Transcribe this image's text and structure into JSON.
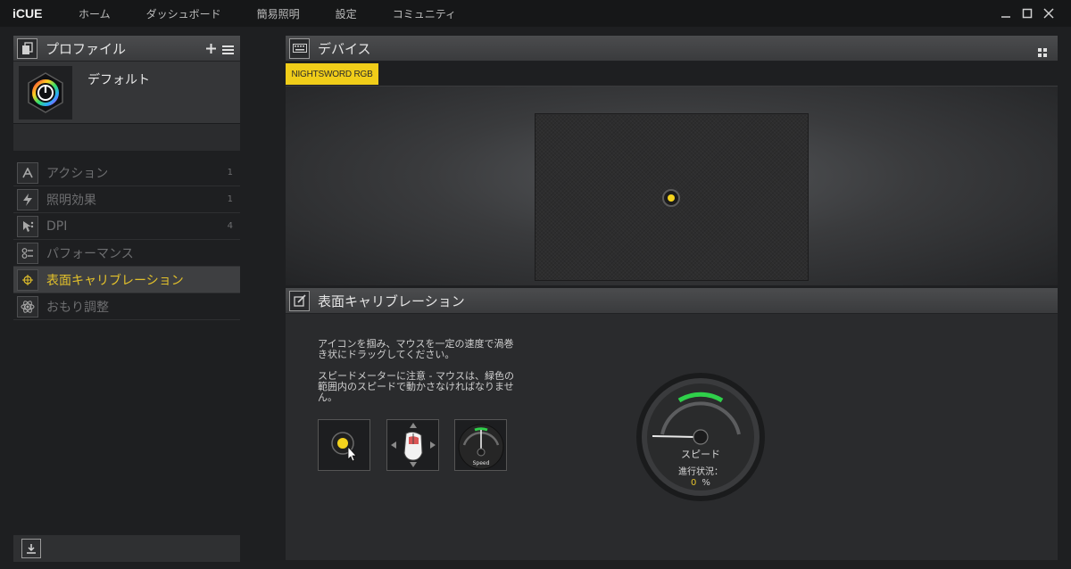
{
  "app": {
    "name": "iCUE"
  },
  "nav": [
    "ホーム",
    "ダッシュボード",
    "簡易照明",
    "設定",
    "コミュニティ"
  ],
  "profiles": {
    "title": "プロファイル",
    "active_profile": "デフォルト"
  },
  "menu": [
    {
      "label": "アクション",
      "count": "1",
      "icon": "action-a-icon"
    },
    {
      "label": "照明効果",
      "count": "1",
      "icon": "lightning-icon"
    },
    {
      "label": "DPI",
      "count": "4",
      "icon": "dpi-cursor-icon"
    },
    {
      "label": "パフォーマンス",
      "count": "",
      "icon": "performance-sliders-icon"
    },
    {
      "label": "表面キャリブレーション",
      "count": "",
      "icon": "crosshair-icon",
      "active": true
    },
    {
      "label": "おもり調整",
      "count": "",
      "icon": "weight-atom-icon"
    }
  ],
  "devices": {
    "title": "デバイス",
    "tabs": [
      "NIGHTSWORD RGB"
    ]
  },
  "calibration": {
    "title": "表面キャリブレーション",
    "instruction_1": "アイコンを掴み、マウスを一定の速度で渦巻き状にドラッグしてください。",
    "instruction_2": "スピードメーターに注意 - マウスは、緑色の範囲内のスピードで動かさなければなりません。",
    "mini_speed_label": "Speed",
    "speed_label": "スピード",
    "progress_label": "進行状況：",
    "progress_value": "0",
    "progress_unit": "%"
  },
  "colors": {
    "accent": "#f0cd19",
    "gauge_green": "#2fd04a",
    "background": "#1e1f21"
  }
}
